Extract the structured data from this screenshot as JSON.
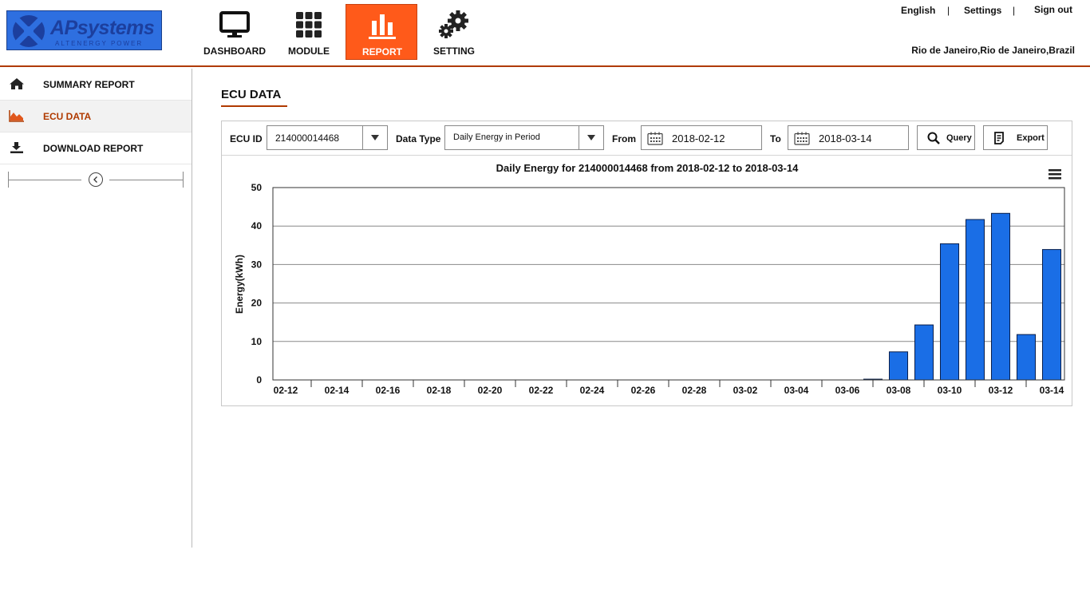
{
  "logo": {
    "brand": "APsystems",
    "tagline": "ALTENERGY POWER"
  },
  "nav": [
    {
      "label": "DASHBOARD",
      "icon": "monitor-icon"
    },
    {
      "label": "MODULE",
      "icon": "grid-icon"
    },
    {
      "label": "REPORT",
      "icon": "bar-chart-icon",
      "active": true
    },
    {
      "label": "SETTING",
      "icon": "gears-icon"
    }
  ],
  "toplinks": {
    "language": "English",
    "settings": "Settings",
    "signout": "Sign out",
    "separator": "|"
  },
  "location": "Rio de Janeiro,Rio de Janeiro,Brazil",
  "sidebar": {
    "items": [
      {
        "label": "SUMMARY REPORT",
        "icon": "home-icon"
      },
      {
        "label": "ECU DATA",
        "icon": "area-chart-icon",
        "active": true
      },
      {
        "label": "DOWNLOAD REPORT",
        "icon": "download-icon"
      }
    ]
  },
  "main": {
    "title": "ECU DATA",
    "toolbar": {
      "ecu_id_label": "ECU ID",
      "ecu_id_value": "214000014468",
      "data_type_label": "Data Type",
      "data_type_value": "Daily Energy in Period",
      "from_label": "From",
      "from_value": "2018-02-12",
      "to_label": "To",
      "to_value": "2018-03-14",
      "query_label": "Query",
      "export_label": "Export"
    }
  },
  "colors": {
    "accent": "#ff5a1a",
    "accent_dark": "#b03a00",
    "bar": "#1a6ee6",
    "logo_bg": "#2e6fe0"
  },
  "chart_data": {
    "type": "bar",
    "title": "Daily Energy for 214000014468 from 2018-02-12 to 2018-03-14",
    "xlabel": "",
    "ylabel": "Energy(kWh)",
    "ylim": [
      0,
      50
    ],
    "yticks": [
      0,
      10,
      20,
      30,
      40,
      50
    ],
    "grid": true,
    "categories": [
      "02-12",
      "02-13",
      "02-14",
      "02-15",
      "02-16",
      "02-17",
      "02-18",
      "02-19",
      "02-20",
      "02-21",
      "02-22",
      "02-23",
      "02-24",
      "02-25",
      "02-26",
      "02-27",
      "02-28",
      "03-01",
      "03-02",
      "03-03",
      "03-04",
      "03-05",
      "03-06",
      "03-07",
      "03-08",
      "03-09",
      "03-10",
      "03-11",
      "03-12",
      "03-13",
      "03-14"
    ],
    "tick_labels": [
      "02-12",
      "02-14",
      "02-16",
      "02-18",
      "02-20",
      "02-22",
      "02-24",
      "02-26",
      "02-28",
      "03-02",
      "03-04",
      "03-06",
      "03-08",
      "03-10",
      "03-12",
      "03-14"
    ],
    "values": [
      0,
      0,
      0,
      0,
      0,
      0,
      0,
      0,
      0,
      0,
      0,
      0,
      0,
      0,
      0,
      0,
      0,
      0,
      0,
      0,
      0,
      0,
      0,
      0.2,
      7.3,
      14.3,
      35.4,
      41.7,
      43.3,
      11.8,
      33.9
    ]
  }
}
